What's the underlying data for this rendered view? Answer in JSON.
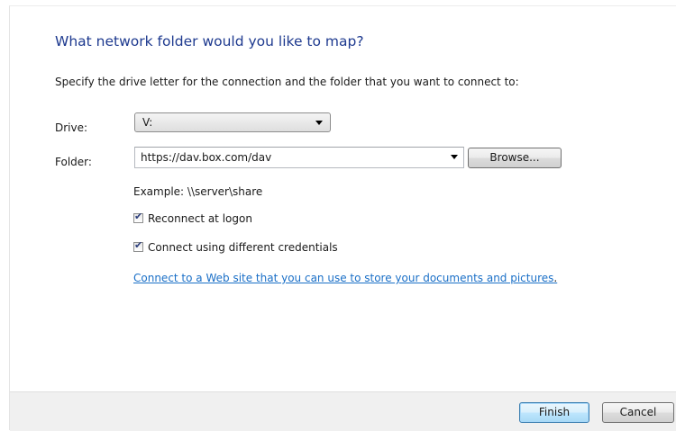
{
  "dialog": {
    "title": "What network folder would you like to map?",
    "instruction": "Specify the drive letter for the connection and the folder that you want to connect to:",
    "drive": {
      "label": "Drive:",
      "value": "V:"
    },
    "folder": {
      "label": "Folder:",
      "value": "https://dav.box.com/dav"
    },
    "browse_label": "Browse...",
    "example": "Example: \\\\server\\share",
    "reconnect": {
      "label": "Reconnect at logon",
      "checked": true
    },
    "credentials": {
      "label": "Connect using different credentials",
      "checked": true
    },
    "link_text": "Connect to a Web site that you can use to store your documents and pictures",
    "link_suffix": "."
  },
  "footer": {
    "finish_label": "Finish",
    "cancel_label": "Cancel"
  },
  "icons": {
    "check": "✔",
    "dropdown": "chevron-down-icon"
  },
  "colors": {
    "title": "#1e3a8f",
    "link": "#1a6fc7",
    "footer_bg": "#f0f0f0"
  }
}
